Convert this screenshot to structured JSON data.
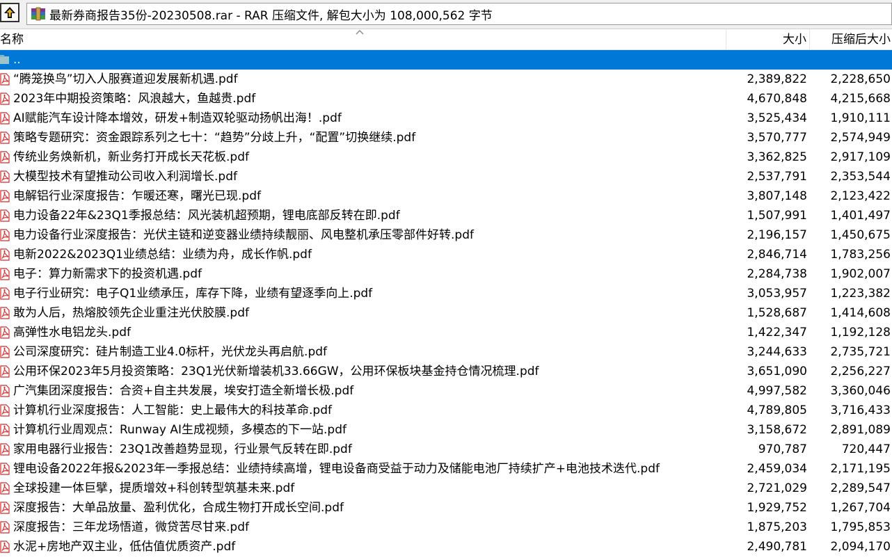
{
  "path_bar": {
    "text": "最新券商报告35份-20230508.rar - RAR 压缩文件, 解包大小为 108,000,562 字节"
  },
  "columns": {
    "name": "名称",
    "size": "大小",
    "packed": "压缩后大小"
  },
  "parent_row": {
    "name": ".."
  },
  "files": [
    {
      "name": "“腾笼换鸟”切入人服赛道迎发展新机遇.pdf",
      "size": "2,389,822",
      "packed": "2,228,650"
    },
    {
      "name": "2023年中期投资策略：风浪越大，鱼越贵.pdf",
      "size": "4,670,848",
      "packed": "4,215,668"
    },
    {
      "name": "AI赋能汽车设计降本增效，研发+制造双轮驱动扬帆出海！.pdf",
      "size": "3,525,434",
      "packed": "1,910,111"
    },
    {
      "name": "策略专题研究：资金跟踪系列之七十：“趋势”分歧上升，“配置”切换继续.pdf",
      "size": "3,570,777",
      "packed": "2,574,949"
    },
    {
      "name": "传统业务焕新机，新业务打开成长天花板.pdf",
      "size": "3,362,825",
      "packed": "2,917,109"
    },
    {
      "name": "大模型技术有望推动公司收入利润增长.pdf",
      "size": "2,537,791",
      "packed": "2,353,544"
    },
    {
      "name": "电解铝行业深度报告：乍暖还寒，曙光已现.pdf",
      "size": "3,807,148",
      "packed": "2,123,422"
    },
    {
      "name": "电力设备22年&23Q1季报总结：风光装机超预期，锂电底部反转在即.pdf",
      "size": "1,507,991",
      "packed": "1,401,497"
    },
    {
      "name": "电力设备行业深度报告：光伏主链和逆变器业绩持续靓丽、风电整机承压零部件好转.pdf",
      "size": "2,196,157",
      "packed": "1,450,675"
    },
    {
      "name": "电新2022&2023Q1业绩总结：业绩为舟，成长作帆.pdf",
      "size": "2,846,714",
      "packed": "1,783,256"
    },
    {
      "name": "电子：算力新需求下的投资机遇.pdf",
      "size": "2,284,738",
      "packed": "1,902,007"
    },
    {
      "name": "电子行业研究：电子Q1业绩承压，库存下降，业绩有望逐季向上.pdf",
      "size": "3,053,957",
      "packed": "1,223,382"
    },
    {
      "name": "敢为人后，热熔胶领先企业重注光伏胶膜.pdf",
      "size": "1,528,687",
      "packed": "1,414,608"
    },
    {
      "name": "高弹性水电铝龙头.pdf",
      "size": "1,422,347",
      "packed": "1,192,128"
    },
    {
      "name": "公司深度研究：硅片制造工业4.0标杆，光伏龙头再启航.pdf",
      "size": "3,244,633",
      "packed": "2,735,721"
    },
    {
      "name": "公用环保2023年5月投资策略：23Q1光伏新增装机33.66GW，公用环保板块基金持仓情况梳理.pdf",
      "size": "3,651,090",
      "packed": "2,256,227"
    },
    {
      "name": "广汽集团深度报告：合资+自主共发展，埃安打造全新增长极.pdf",
      "size": "4,997,582",
      "packed": "3,360,046"
    },
    {
      "name": "计算机行业深度报告：人工智能：史上最伟大的科技革命.pdf",
      "size": "4,789,805",
      "packed": "3,716,433"
    },
    {
      "name": "计算机行业周观点：Runway AI生成视频，多模态的下一站.pdf",
      "size": "3,158,672",
      "packed": "2,891,089"
    },
    {
      "name": "家用电器行业报告：23Q1改善趋势显现，行业景气反转在即.pdf",
      "size": "970,787",
      "packed": "720,447"
    },
    {
      "name": "锂电设备2022年报&2023年一季报总结：业绩持续高增，锂电设备商受益于动力及储能电池厂持续扩产+电池技术迭代.pdf",
      "size": "2,459,034",
      "packed": "2,171,195"
    },
    {
      "name": "全球投建一体巨擘，提质增效+科创转型筑基未来.pdf",
      "size": "2,721,029",
      "packed": "2,289,547"
    },
    {
      "name": "深度报告：大单品放量、盈利优化，合成生物打开成长空间.pdf",
      "size": "1,929,752",
      "packed": "1,267,704"
    },
    {
      "name": "深度报告：三年龙场悟道，微贷苦尽甘来.pdf",
      "size": "1,875,203",
      "packed": "1,795,853"
    },
    {
      "name": "水泥+房地产双主业，低估值优质资产.pdf",
      "size": "2,490,781",
      "packed": "2,094,170"
    }
  ],
  "icons": {
    "up": "up-arrow-icon",
    "archive": "winrar-archive-icon",
    "folder": "folder-icon",
    "file": "pdf-file-icon"
  },
  "colors": {
    "selection": "#0078d7",
    "pdf_red": "#d62b2b"
  }
}
